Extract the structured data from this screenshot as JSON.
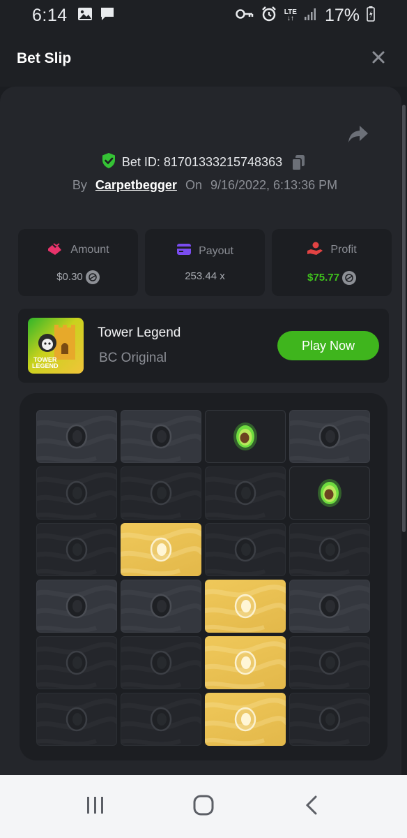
{
  "status_bar": {
    "time": "6:14",
    "battery": "17%",
    "network": "LTE"
  },
  "header": {
    "title": "Bet Slip"
  },
  "bet": {
    "id_label": "Bet ID: 81701333215748363",
    "by_label": "By",
    "user": "Carpetbegger",
    "on_label": "On",
    "datetime": "9/16/2022, 6:13:36 PM"
  },
  "stats": {
    "amount_label": "Amount",
    "amount_value": "$0.30",
    "payout_label": "Payout",
    "payout_value": "253.44 x",
    "profit_label": "Profit",
    "profit_value": "$75.77"
  },
  "game": {
    "name": "Tower Legend",
    "provider": "BC Original",
    "thumb_caption_line1": "TOWER",
    "thumb_caption_line2": "LEGEND",
    "play_label": "Play Now"
  },
  "board": {
    "rows": [
      [
        "light",
        "light",
        "found",
        "light"
      ],
      [
        "dark",
        "dark",
        "dark",
        "found"
      ],
      [
        "dark",
        "gold",
        "dark",
        "dark"
      ],
      [
        "light",
        "light",
        "gold",
        "light"
      ],
      [
        "dark",
        "dark",
        "gold",
        "dark"
      ],
      [
        "dark",
        "dark",
        "gold",
        "dark"
      ]
    ]
  },
  "colors": {
    "accent_green": "#3fb51d",
    "profit_green": "#3fc31c",
    "gold_tile": "#e9c150",
    "shield_green": "#35c235"
  },
  "icons": [
    "image-icon",
    "message-icon",
    "key-icon",
    "alarm-icon",
    "signal-icon",
    "battery-icon",
    "close-icon",
    "share-icon",
    "shield-check-icon",
    "copy-icon",
    "amount-icon",
    "payout-card-icon",
    "profit-hand-icon",
    "coin-icon",
    "recent-apps-icon",
    "home-icon",
    "back-icon"
  ]
}
